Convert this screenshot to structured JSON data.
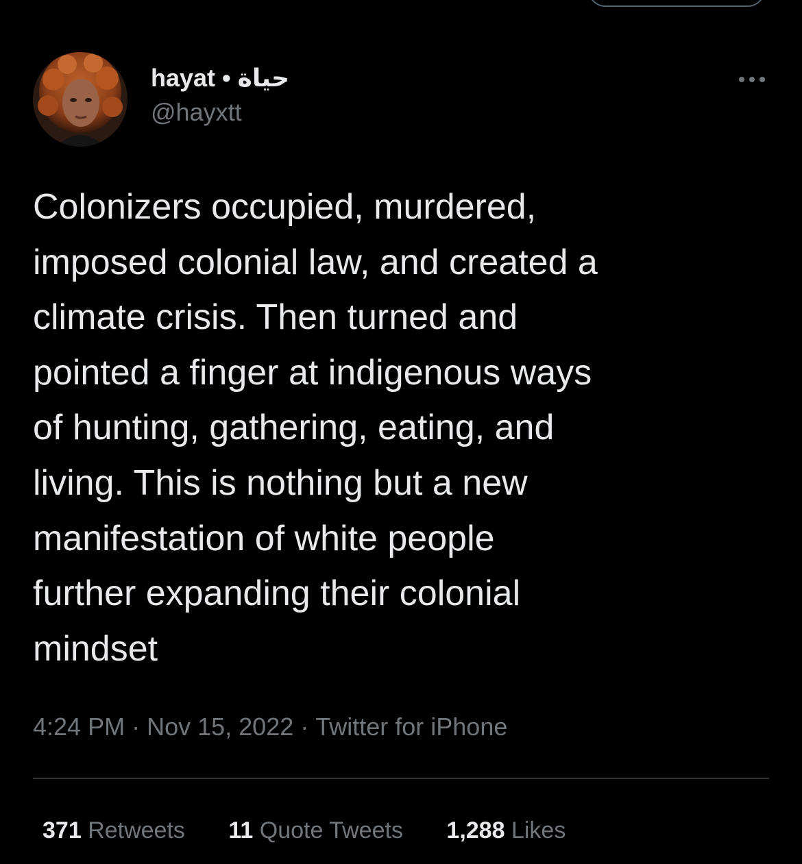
{
  "tweet": {
    "author": {
      "display_name": "hayat • حياة",
      "handle": "@hayxtt"
    },
    "text": "Colonizers occupied, murdered,\nimposed colonial law, and created a\nclimate crisis. Then turned and\npointed a finger at indigenous ways\nof hunting, gathering, eating, and\nliving. This is nothing but a new\nmanifestation of white people\nfurther expanding their colonial\nmindset",
    "time": "4:24 PM",
    "date": "Nov 15, 2022",
    "source": "Twitter for iPhone",
    "separator": "·",
    "stats": {
      "retweets": {
        "count": "371",
        "label": "Retweets"
      },
      "quote_tweets": {
        "count": "11",
        "label": "Quote Tweets"
      },
      "likes": {
        "count": "1,288",
        "label": "Likes"
      }
    }
  },
  "icons": {
    "more": "more-horizontal-icon"
  },
  "colors": {
    "background": "#000000",
    "primary_text": "#e7e9ea",
    "secondary_text": "#71767b",
    "divider": "#2f3336"
  }
}
